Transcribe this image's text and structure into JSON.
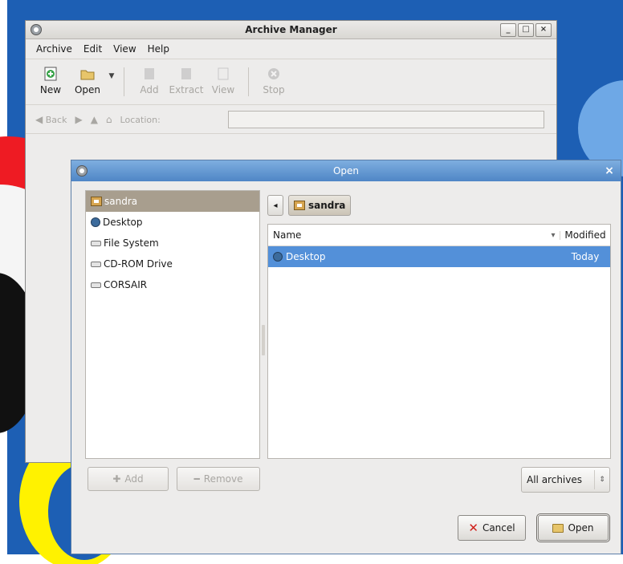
{
  "archive_manager": {
    "title": "Archive Manager",
    "window_buttons": [
      "_",
      "□",
      "×"
    ],
    "menu": [
      "Archive",
      "Edit",
      "View",
      "Help"
    ],
    "toolbar": {
      "new": "New",
      "open": "Open",
      "add": "Add",
      "extract": "Extract",
      "view": "View",
      "stop": "Stop"
    },
    "locbar": {
      "back": "Back",
      "location_label": "Location:"
    }
  },
  "open_dialog": {
    "title": "Open",
    "close": "×",
    "places": [
      {
        "label": "sandra",
        "icon": "home-folder-icon",
        "selected": true
      },
      {
        "label": "Desktop",
        "icon": "desktop-icon",
        "selected": false
      },
      {
        "label": "File System",
        "icon": "drive-icon",
        "selected": false
      },
      {
        "label": "CD-ROM Drive",
        "icon": "cdrom-icon",
        "selected": false
      },
      {
        "label": "CORSAIR",
        "icon": "usb-drive-icon",
        "selected": false
      }
    ],
    "path": {
      "back_arrow": "◂",
      "current": "sandra"
    },
    "columns": {
      "name": "Name",
      "sort": "▾",
      "modified": "Modified"
    },
    "files": [
      {
        "name": "Desktop",
        "modified": "Today",
        "selected": true
      }
    ],
    "add_button": "Add",
    "remove_button": "Remove",
    "filter": {
      "selected": "All archives",
      "arrow": "⇕"
    },
    "cancel_button": "Cancel",
    "open_button": "Open",
    "colors": {
      "title_bar": "#5d92d0",
      "selection": "#5390d9",
      "places_selection": "#a89e8e"
    }
  }
}
